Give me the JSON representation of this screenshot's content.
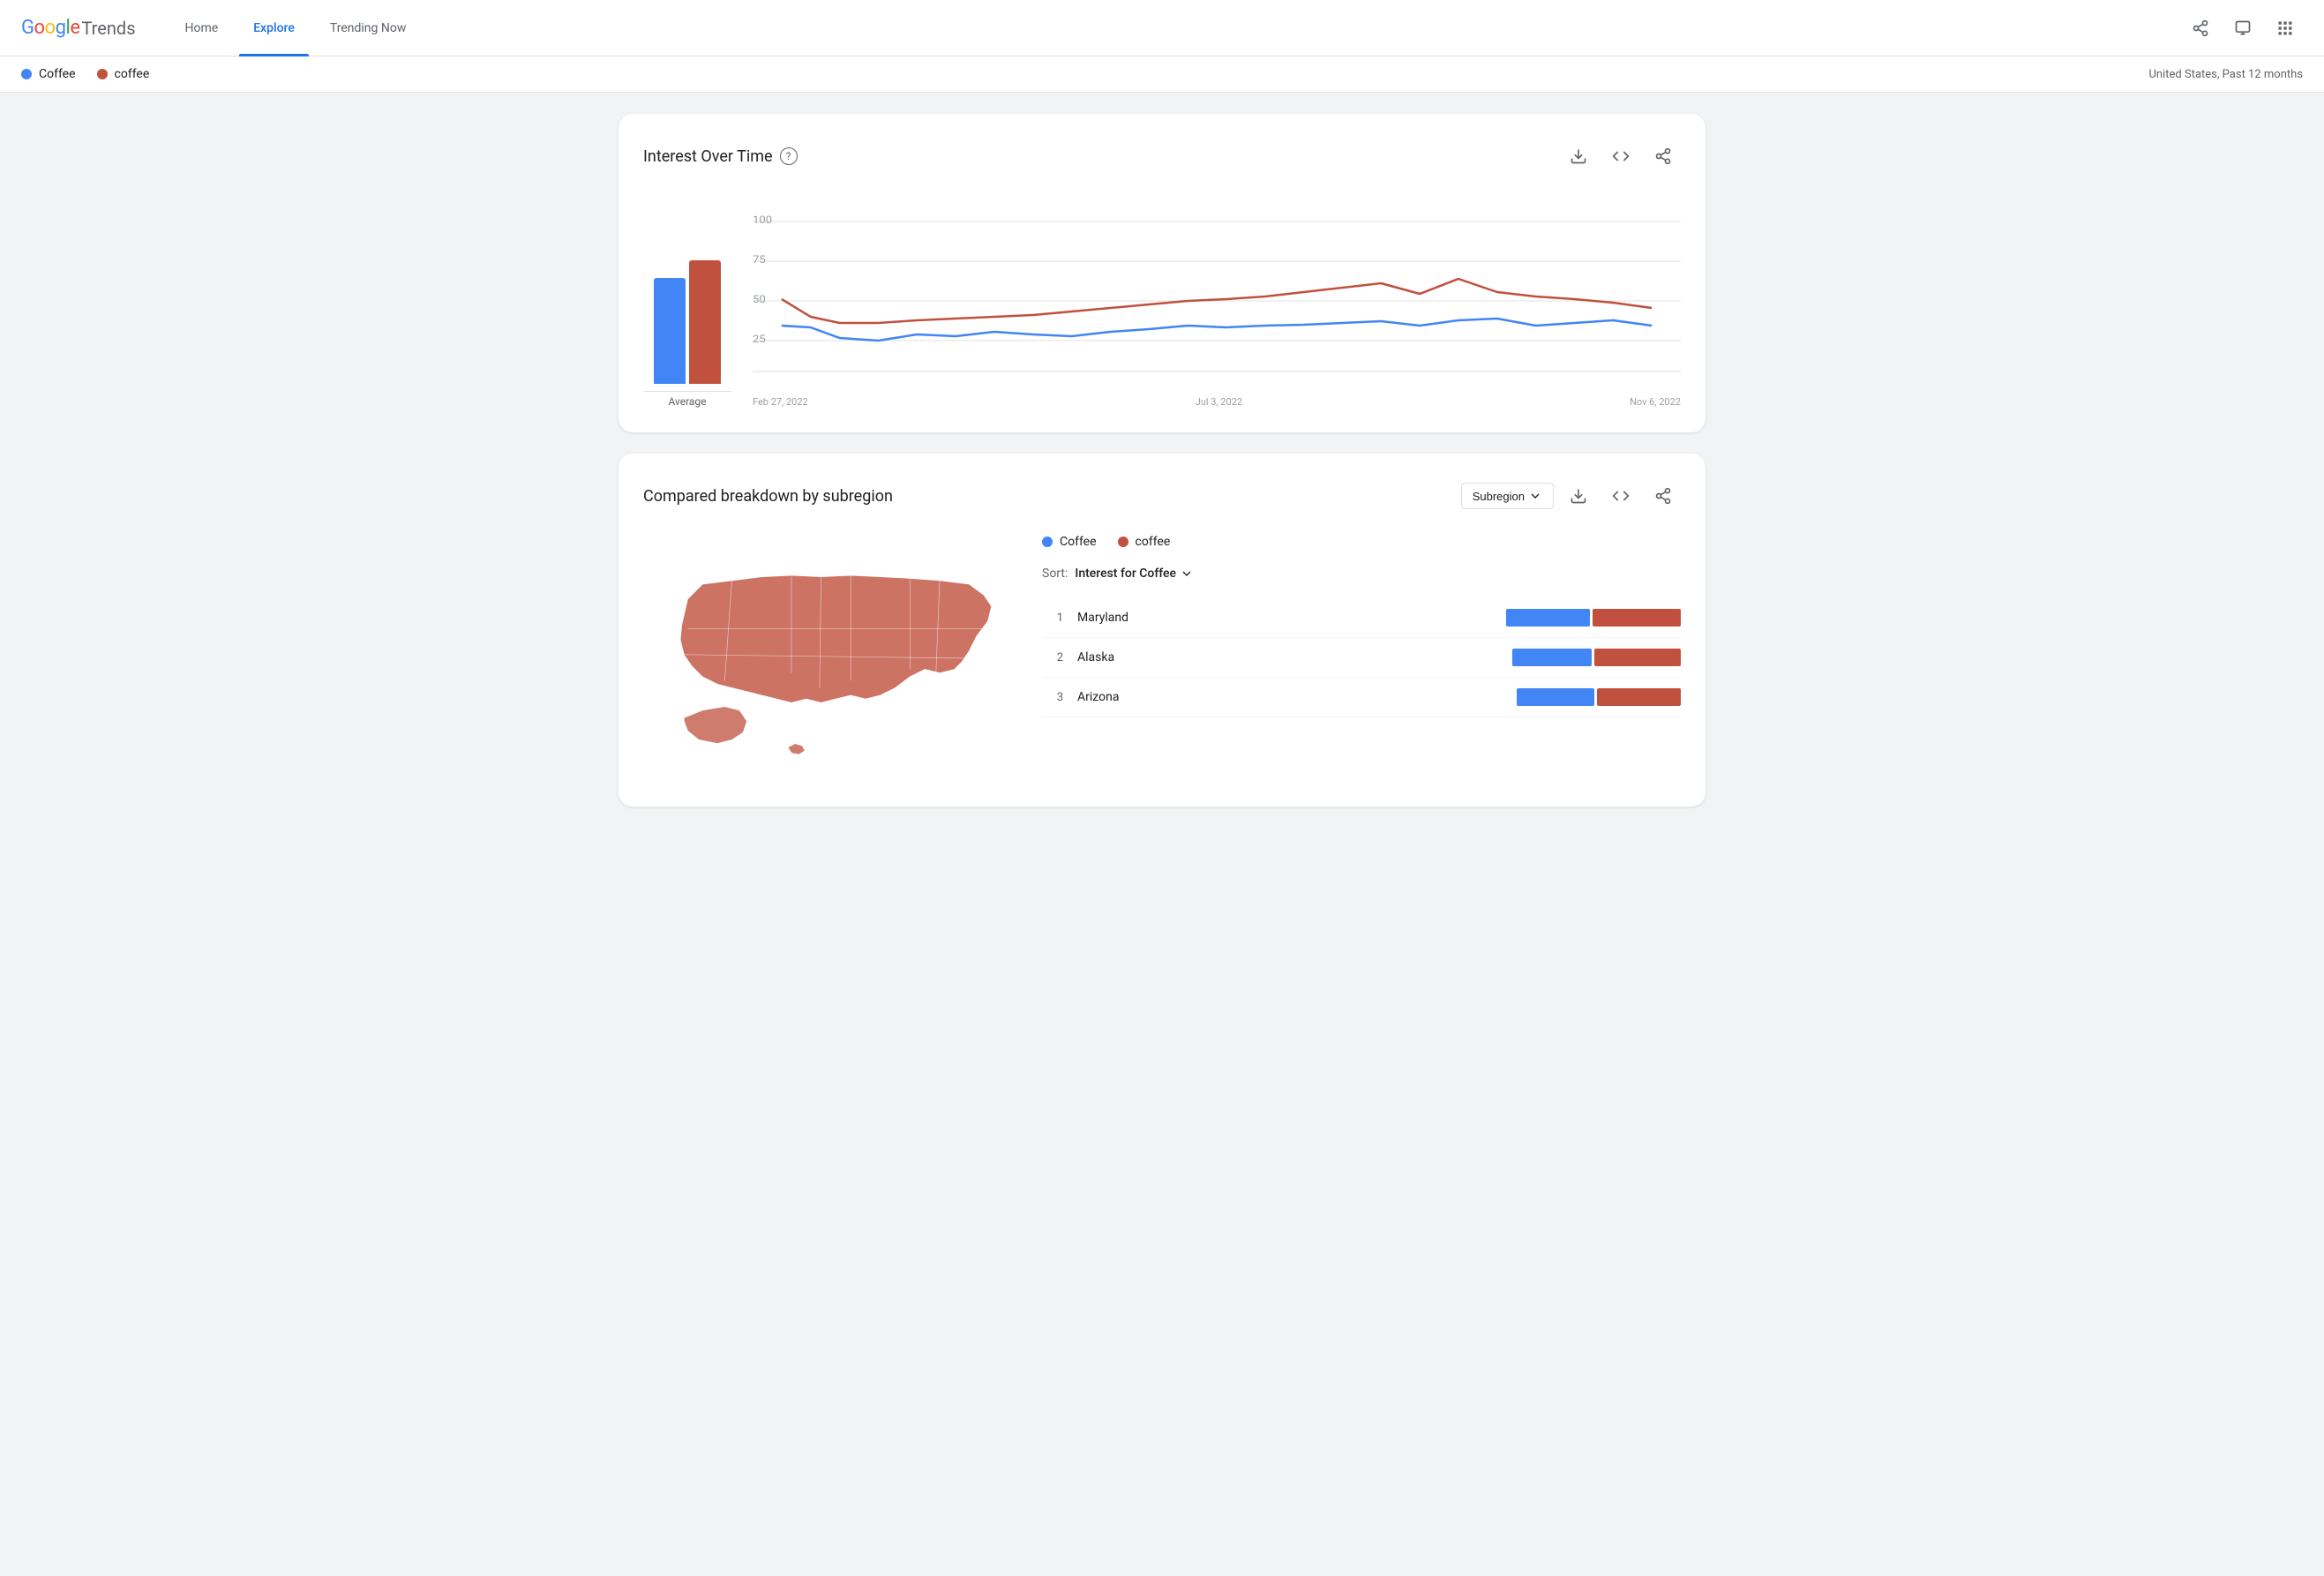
{
  "header": {
    "logo_google": "Google",
    "logo_trends": "Trends",
    "nav": [
      {
        "id": "home",
        "label": "Home",
        "active": false
      },
      {
        "id": "explore",
        "label": "Explore",
        "active": true
      },
      {
        "id": "trending",
        "label": "Trending Now",
        "active": false
      }
    ],
    "icons": [
      {
        "id": "share",
        "symbol": "↗",
        "name": "share-icon"
      },
      {
        "id": "feedback",
        "symbol": "⬜",
        "name": "feedback-icon"
      },
      {
        "id": "apps",
        "symbol": "⋮⋮⋮",
        "name": "apps-icon"
      }
    ]
  },
  "legend": {
    "items": [
      {
        "id": "coffee-cap",
        "label": "Coffee",
        "color": "#4285f4"
      },
      {
        "id": "coffee-lower",
        "label": "coffee",
        "color": "#c0513e"
      }
    ],
    "region_info": "United States, Past 12 months"
  },
  "interest_over_time": {
    "title": "Interest Over Time",
    "help_text": "?",
    "y_labels": [
      "100",
      "75",
      "50",
      "25"
    ],
    "x_labels": [
      "Feb 27, 2022",
      "Jul 3, 2022",
      "Nov 6, 2022"
    ],
    "avg_label": "Average",
    "avg_bars": [
      {
        "color": "#4285f4",
        "height": 75
      },
      {
        "color": "#c0513e",
        "height": 88
      }
    ],
    "blue_line_points": "0,145 50,150 100,165 150,168 200,160 250,163 300,158 350,160 360,162 400,155 450,152 500,148 550,150 600,148 650,145 700,143 750,148 800,143 850,142 900,148 950,145",
    "red_line_points": "0,125 50,140 100,148 150,148 200,145 250,143 300,142 350,140 360,138 400,130 450,128 500,125 550,122 600,118 650,112 700,108 750,115 800,105 850,118 900,120 950,128"
  },
  "subregion": {
    "title": "Compared breakdown by subregion",
    "dropdown_label": "Subregion",
    "legend_items": [
      {
        "label": "Coffee",
        "color": "#4285f4"
      },
      {
        "label": "coffee",
        "color": "#c0513e"
      }
    ],
    "sort_label": "Sort:",
    "sort_value": "Interest for Coffee",
    "rows": [
      {
        "rank": 1,
        "name": "Maryland",
        "blue_width": 95,
        "red_width": 100
      },
      {
        "rank": 2,
        "name": "Alaska",
        "blue_width": 90,
        "red_width": 98
      },
      {
        "rank": 3,
        "name": "Arizona",
        "blue_width": 88,
        "red_width": 95
      }
    ],
    "bar_colors": {
      "blue": "#4285f4",
      "red": "#c0513e"
    }
  },
  "subregion_legend": {
    "coffee_lower": "coffee"
  }
}
